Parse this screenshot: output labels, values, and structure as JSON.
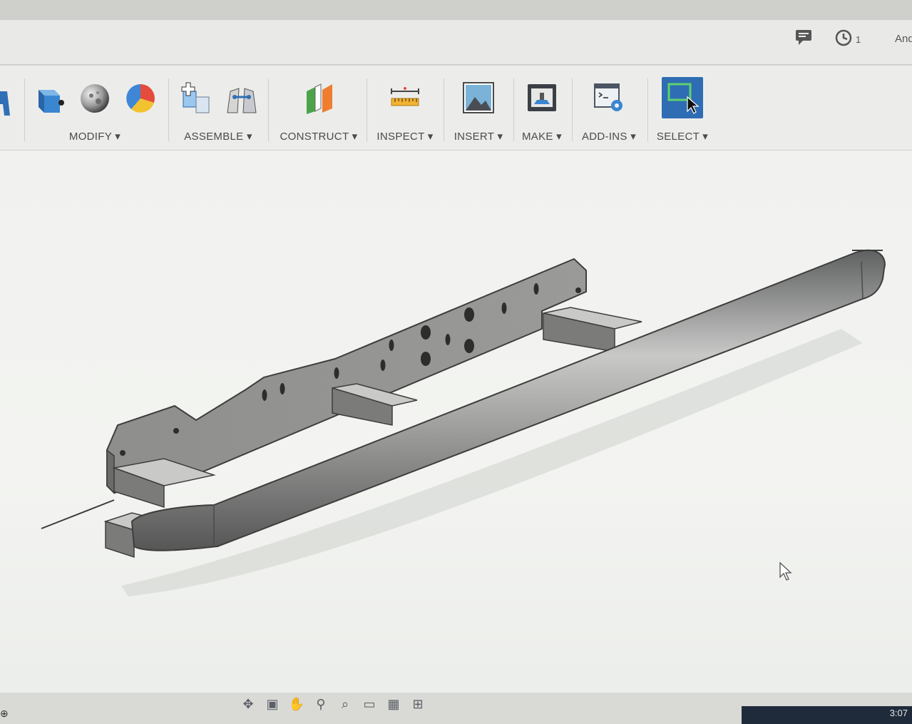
{
  "header": {
    "history_count": "1",
    "user_name": "And"
  },
  "toolbar": {
    "groups": [
      {
        "label": "MODIFY"
      },
      {
        "label": "ASSEMBLE"
      },
      {
        "label": "CONSTRUCT"
      },
      {
        "label": "INSPECT"
      },
      {
        "label": "INSERT"
      },
      {
        "label": "MAKE"
      },
      {
        "label": "ADD-INS"
      },
      {
        "label": "SELECT"
      }
    ],
    "dropdown_glyph": "▾"
  },
  "navbar": {
    "icons": [
      "orbit-icon",
      "look-at-icon",
      "pan-icon",
      "zoom-icon",
      "fit-icon",
      "display-settings-icon",
      "grid-icon",
      "viewports-icon"
    ]
  },
  "taskbar": {
    "time": "3:07"
  },
  "colors": {
    "accent_select": "#2e6db4",
    "model_gray": "#8d8e8c"
  }
}
